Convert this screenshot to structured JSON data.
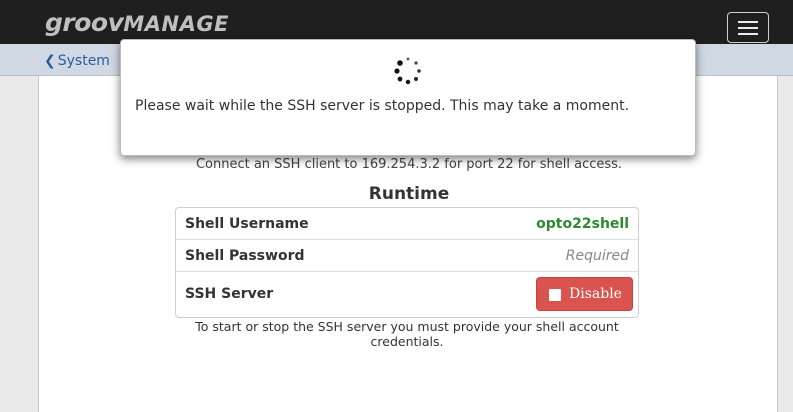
{
  "header": {
    "logo_groov": "groov",
    "logo_manage": "MANAGE",
    "menu_icon": "hamburger-menu-icon"
  },
  "nav": {
    "back_label": "System",
    "back_icon": "chevron-left-icon"
  },
  "content": {
    "connect_text": "Connect an SSH client to 169.254.3.2 for port 22 for shell access.",
    "section_title": "Runtime",
    "rows": [
      {
        "label": "Shell Username",
        "value": "opto22shell"
      },
      {
        "label": "Shell Password",
        "value": "Required"
      },
      {
        "label": "SSH Server",
        "button": "Disable"
      }
    ],
    "note": "To start or stop the SSH server you must provide your shell account credentials."
  },
  "modal": {
    "message": "Please wait while the SSH server is stopped. This may take a moment.",
    "spinner_icon": "loading-spinner-icon"
  },
  "colors": {
    "topbar": "#1f1f1f",
    "navbar": "#cfd8e3",
    "username": "#2f8a2f",
    "disable_button": "#d9534f"
  }
}
